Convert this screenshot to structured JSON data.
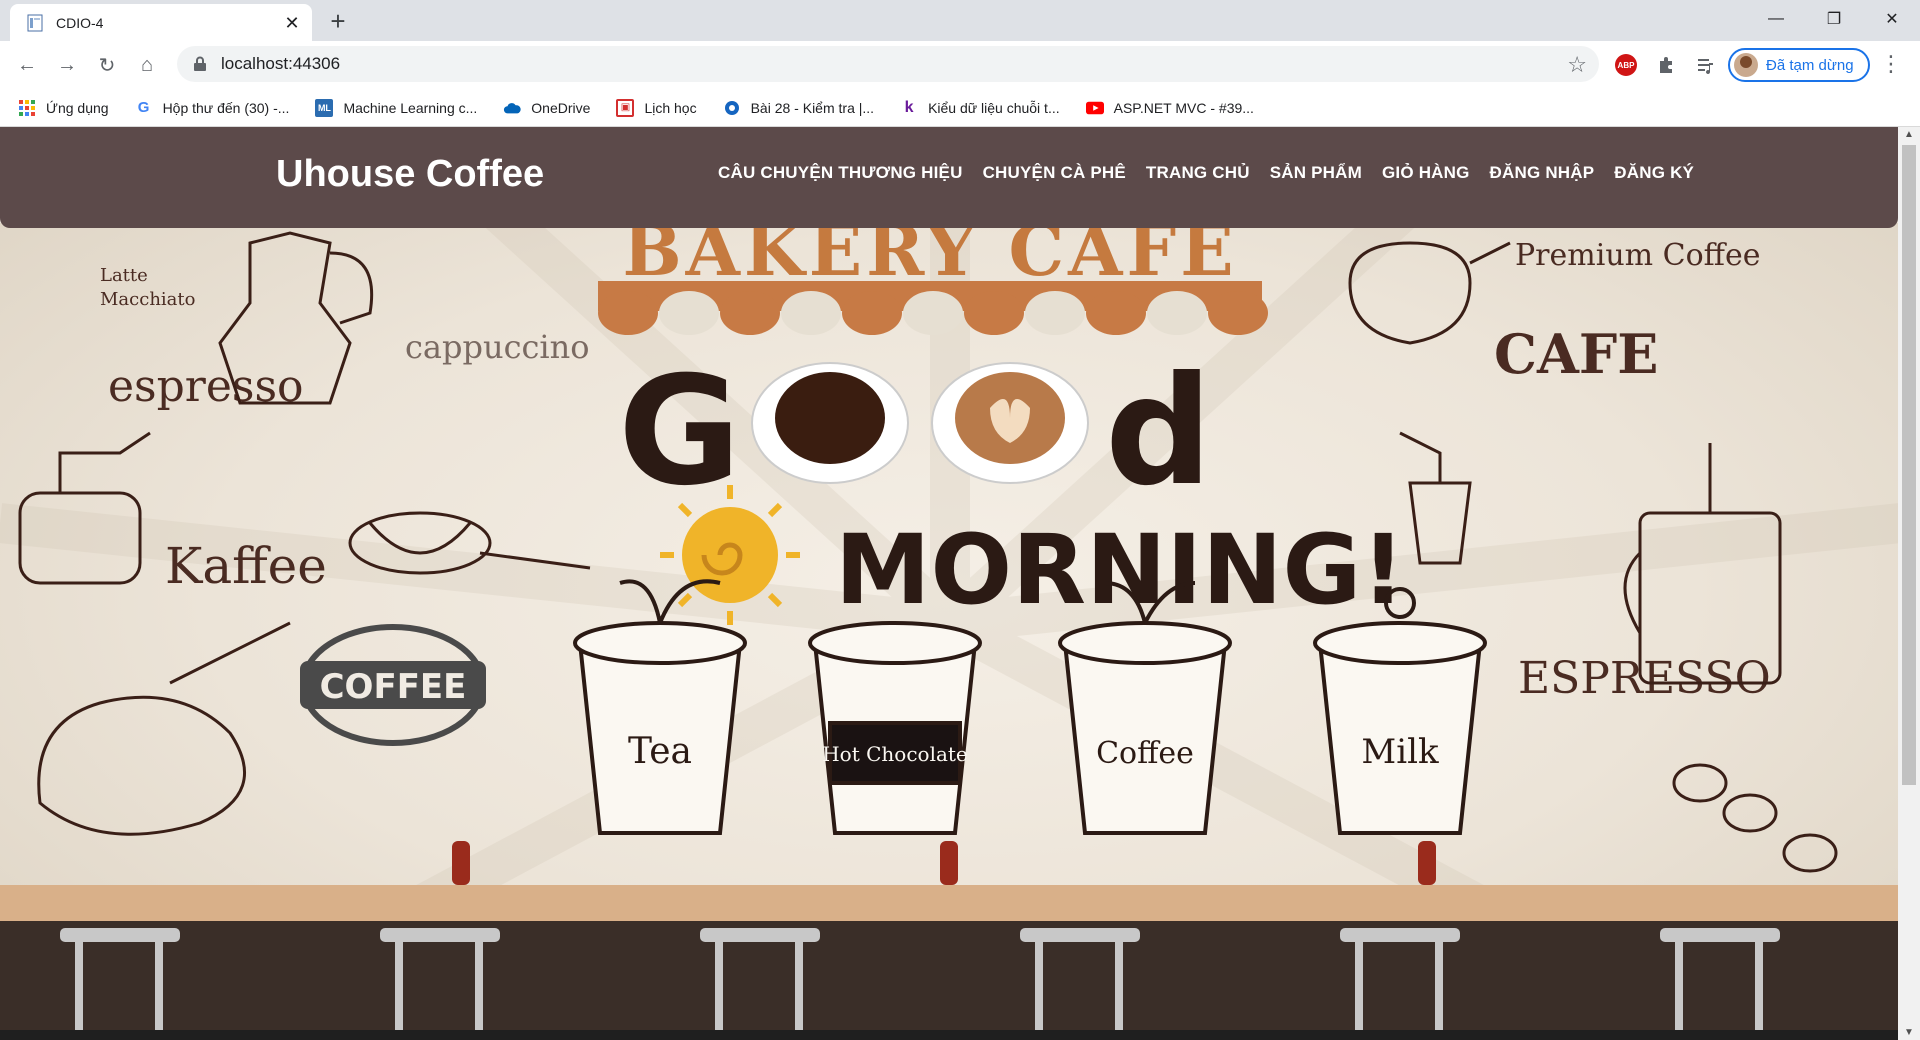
{
  "browser": {
    "tab_title": "CDIO-4",
    "url": "localhost:44306",
    "profile_label": "Đã tạm dừng",
    "bookmarks": [
      {
        "label": "Ứng dụng",
        "icon": "apps-grid-icon"
      },
      {
        "label": "Hộp thư đến (30) -...",
        "icon": "google-icon"
      },
      {
        "label": "Machine Learning c...",
        "icon": "ml-icon"
      },
      {
        "label": "OneDrive",
        "icon": "onedrive-cloud-icon"
      },
      {
        "label": "Lịch học",
        "icon": "calendar-icon"
      },
      {
        "label": "Bài 28 - Kiểm tra |...",
        "icon": "site-icon"
      },
      {
        "label": "Kiểu dữ liệu chuỗi t...",
        "icon": "k-logo-icon"
      },
      {
        "label": "ASP.NET MVC - #39...",
        "icon": "youtube-icon"
      }
    ]
  },
  "site": {
    "brand": "Uhouse Coffee",
    "menu": [
      "CÂU CHUYỆN THƯƠNG HIỆU",
      "CHUYỆN CÀ PHÊ",
      "TRANG CHỦ",
      "SẢN PHẨM",
      "GIỎ HÀNG",
      "ĐĂNG NHẬP",
      "ĐĂNG KÝ"
    ],
    "hero": {
      "headline_top": "BAKERY CAFE",
      "good_g": "G",
      "good_d": "d",
      "morning": "MORNING!",
      "words": [
        "Latte",
        "Macchiato",
        "cappuccino",
        "espresso",
        "Kaffee",
        "COFFEE",
        "Premium Coffee",
        "CAFE",
        "ESPRESSO"
      ],
      "cups": [
        "Tea",
        "Hot Chocolate",
        "Coffee",
        "Milk"
      ],
      "slides": 3,
      "active_slide": 1
    }
  },
  "colors": {
    "nav_bg": "#5c4a4a",
    "ink": "#3a1f17",
    "awning_orange": "#c77a45",
    "bakery_orange": "#c57a3f",
    "sun": "#f0b429",
    "accent_blue": "#1a73e8"
  }
}
